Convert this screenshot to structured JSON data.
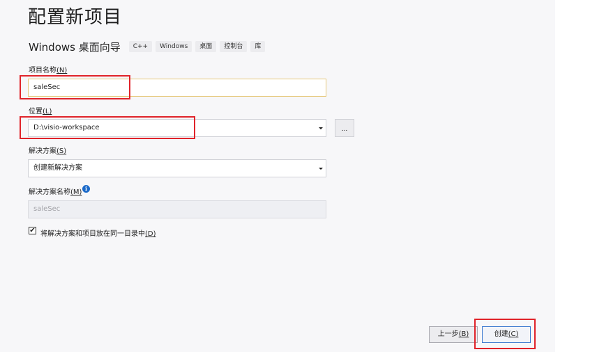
{
  "title": "配置新项目",
  "subtitle": "Windows 桌面向导",
  "tags": [
    "C++",
    "Windows",
    "桌面",
    "控制台",
    "库"
  ],
  "project_name": {
    "label": "项目名称",
    "accelerator": "(N)",
    "value": "saleSec"
  },
  "location": {
    "label": "位置",
    "accelerator": "(L)",
    "value": "D:\\visio-workspace",
    "browse_label": "..."
  },
  "solution": {
    "label": "解决方案",
    "accelerator": "(S)",
    "value": "创建新解决方案"
  },
  "solution_name": {
    "label": "解决方案名称",
    "accelerator": "(M)",
    "placeholder": "saleSec",
    "info_icon": "i"
  },
  "same_dir": {
    "checked": true,
    "check_glyph": "✔",
    "label": "将解决方案和项目放在同一目录中",
    "accelerator": "(D)"
  },
  "buttons": {
    "back": {
      "label": "上一步",
      "accelerator": "(B)"
    },
    "create": {
      "label": "创建",
      "accelerator": "(C)"
    }
  },
  "colors": {
    "highlight_box": "#e0232a",
    "primary_border": "#3e7bd0"
  }
}
